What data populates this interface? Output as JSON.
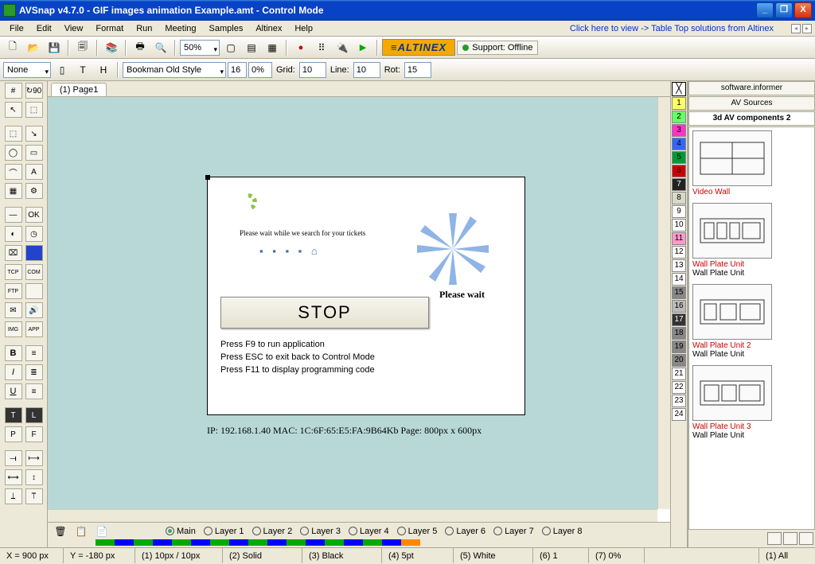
{
  "window": {
    "title": "AVSnap v4.7.0 - GIF images animation Example.amt  - Control Mode",
    "min": "_",
    "max": "❐",
    "close": "X"
  },
  "menu": [
    "File",
    "Edit",
    "View",
    "Format",
    "Run",
    "Meeting",
    "Samples",
    "Altinex",
    "Help"
  ],
  "promo": "Click here to view -> Table Top solutions from Altinex",
  "toolbar": {
    "zoom": "50%",
    "brand": "≡ALTINEX",
    "support": "Support: Offline"
  },
  "optbar": {
    "style_none": "None",
    "t": "T",
    "h": "H",
    "font": "Bookman Old Style",
    "size": "16",
    "pct": "0%",
    "grid_label": "Grid:",
    "grid": "10",
    "line_label": "Line:",
    "line": "10",
    "rot_label": "Rot:",
    "rot": "15"
  },
  "tab": "(1) Page1",
  "page": {
    "search": "Please wait while we search for your tickets",
    "dots": "▪ ▪ ▪ ▪  ⌂",
    "please_wait": "Please wait",
    "stop": "STOP",
    "help1": "Press F9 to run application",
    "help2": "Press ESC to exit back to Control Mode",
    "help3": "Press F11 to display programming code",
    "ipline": "IP: 192.168.1.40   MAC: 1C:6F:65:E5:FA:9B64Kb    Page: 800px x 600px"
  },
  "numstrip_colors": [
    "#ffff66",
    "#66ff66",
    "#ff33cc",
    "#3366ff",
    "#009933",
    "#cc0000",
    "#222222",
    "#d9d9c8",
    "#ffffff",
    "#ffffff",
    "#ff99cc",
    "#ffffff",
    "#ffffff",
    "#ffffff",
    "#888888",
    "#bbbbbb",
    "#333333",
    "#888888",
    "#888888",
    "#888888",
    "#ffffff",
    "#ffffff",
    "#ffffff",
    "#ffffff"
  ],
  "rpanel": {
    "tab1": "software.informer",
    "tab2": "AV Sources",
    "tab3": "3d AV components 2",
    "items": [
      {
        "name": "Video Wall",
        "sub": ""
      },
      {
        "name": "Wall Plate Unit",
        "sub": "Wall Plate Unit"
      },
      {
        "name": "Wall Plate Unit 2",
        "sub": "Wall Plate Unit"
      },
      {
        "name": "Wall Plate Unit 3",
        "sub": "Wall Plate Unit"
      }
    ]
  },
  "layers": {
    "main": "Main",
    "l": [
      "Layer 1",
      "Layer 2",
      "Layer 3",
      "Layer 4",
      "Layer 5",
      "Layer 6",
      "Layer 7",
      "Layer 8"
    ]
  },
  "status": {
    "x": "X = 900 px",
    "y": "Y = -180 px",
    "s1": "(1) 10px / 10px",
    "s2": "(2) Solid",
    "s3": "(3) Black",
    "s4": "(4) 5pt",
    "s5": "(5) White",
    "s6": "(6) 1",
    "s7": "(7) 0%",
    "all": "(1) All"
  },
  "ltool_labels": {
    "grid": "#",
    "r90": "↻90",
    "cur": "↖",
    "nav": "⬚",
    "sel": "⬚",
    "ptr": "↘",
    "el": "◯",
    "rc": "▭",
    "arc": "⌒",
    "A": "A",
    "tbl": "▦",
    "gear": "⚙",
    "dash": "—",
    "ok": "OK",
    "sld": "◐",
    "clk": "◷",
    "cyl": "⌧",
    "blu": "■",
    "tcp": "TCP",
    "com": "COM",
    "ftp": "FTP",
    "env": "✉",
    "sp": "🔊",
    "img": "IMG",
    "app": "APP",
    "B": "B",
    "lst": "≡",
    "I": "I",
    "al": "≣",
    "U": "U",
    "tl": "≡",
    "T": "T",
    "L": "L",
    "P": "P",
    "F": "F",
    "a1": "⟞",
    "a2": "⟼",
    "a3": "⟷",
    "a4": "↕",
    "a5": "⟘",
    "a6": "⟙"
  }
}
